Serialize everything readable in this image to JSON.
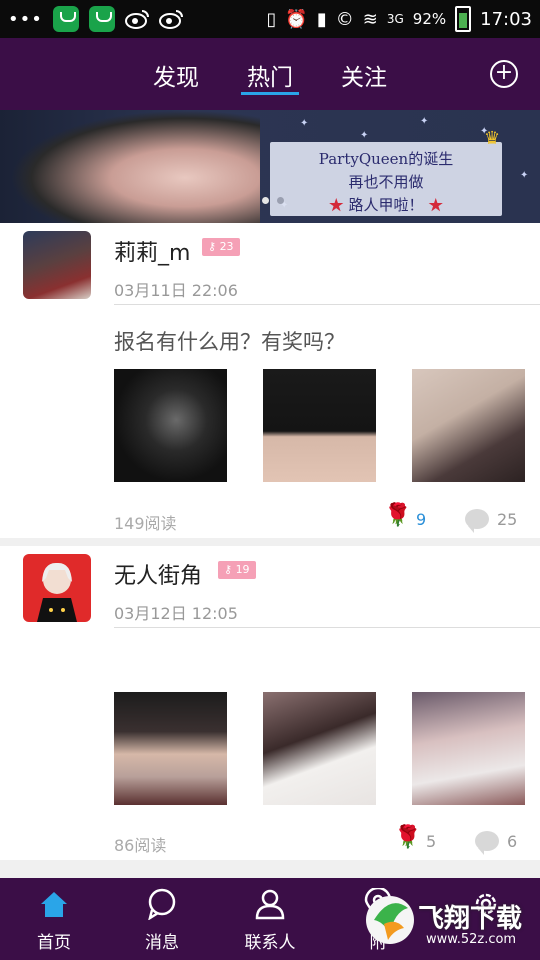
{
  "status_bar": {
    "battery_percent": "92%",
    "time": "17:03",
    "network_text": "3G"
  },
  "top_nav": {
    "tabs": [
      {
        "label": "发现",
        "active": false
      },
      {
        "label": "热门",
        "active": true
      },
      {
        "label": "关注",
        "active": false
      }
    ],
    "add_icon": "plus-circle-icon"
  },
  "banner": {
    "line1": "PartyQueen的诞生",
    "line2": "再也不用做",
    "line3": "路人甲啦！",
    "star_mark": "★",
    "active_dot": 1
  },
  "posts": [
    {
      "username": "莉莉_m",
      "badge": "23",
      "time": "03月11日 22:06",
      "text": "报名有什么用？有奖吗？",
      "reads": "149阅读",
      "roses": "9",
      "comments": "25"
    },
    {
      "username": "无人街角",
      "badge": "19",
      "time": "03月12日 12:05",
      "text": "",
      "reads": "86阅读",
      "roses": "5",
      "comments": "6"
    }
  ],
  "bottom_nav": {
    "items": [
      {
        "label": "首页",
        "icon": "home-icon",
        "active": true
      },
      {
        "label": "消息",
        "icon": "message-icon",
        "active": false
      },
      {
        "label": "联系人",
        "icon": "contacts-icon",
        "active": false
      },
      {
        "label": "附",
        "icon": "location-icon",
        "active": false
      },
      {
        "label": "",
        "icon": "settings-icon",
        "active": false
      }
    ]
  },
  "watermark": {
    "title": "飞翔下载",
    "url": "www.52z.com"
  },
  "colors": {
    "nav_bg": "#3b0e47",
    "accent": "#2aa5e8",
    "badge": "#f5a0b6",
    "rose": "#c0192b"
  }
}
